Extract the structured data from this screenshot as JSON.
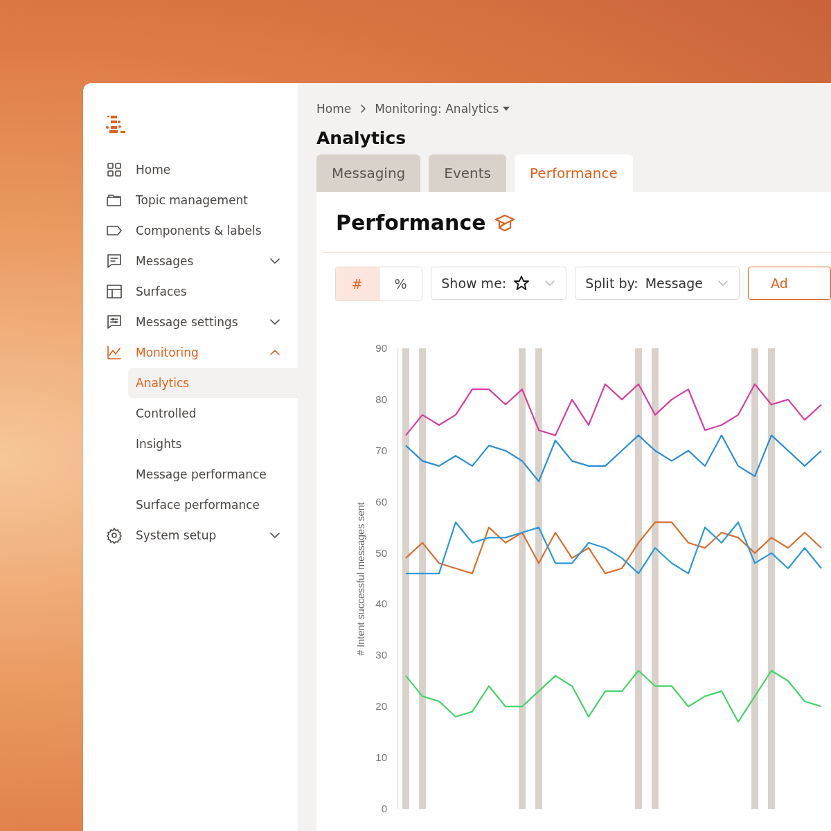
{
  "sidebar": {
    "items": [
      {
        "label": "Home",
        "kind": "link",
        "selected": false
      },
      {
        "label": "Topic management",
        "kind": "link",
        "selected": false
      },
      {
        "label": "Components & labels",
        "kind": "link",
        "selected": false
      },
      {
        "label": "Messages",
        "kind": "group",
        "selected": false,
        "expanded": false
      },
      {
        "label": "Surfaces",
        "kind": "link",
        "selected": false
      },
      {
        "label": "Message settings",
        "kind": "group",
        "selected": false,
        "expanded": false
      },
      {
        "label": "Monitoring",
        "kind": "group",
        "selected": true,
        "expanded": true,
        "children": [
          {
            "label": "Analytics",
            "selected": true
          },
          {
            "label": "Controlled",
            "selected": false
          },
          {
            "label": "Insights",
            "selected": false
          },
          {
            "label": "Message performance",
            "selected": false
          },
          {
            "label": "Surface performance",
            "selected": false
          }
        ]
      },
      {
        "label": "System setup",
        "kind": "group",
        "selected": false,
        "expanded": false
      }
    ]
  },
  "breadcrumb": [
    "Home",
    "Monitoring: Analytics"
  ],
  "page_title": "Analytics",
  "tabs": [
    {
      "label": "Messaging",
      "selected": false
    },
    {
      "label": "Events",
      "selected": false
    },
    {
      "label": "Performance",
      "selected": true
    }
  ],
  "panel": {
    "title": "Performance",
    "toolbar": {
      "units": [
        {
          "label": "#",
          "selected": true
        },
        {
          "label": "%",
          "selected": false
        }
      ],
      "show_me": {
        "label": "Show me:"
      },
      "split_by": {
        "label": "Split by:",
        "value": "Message"
      },
      "add_button": "Ad"
    },
    "chart_data": {
      "type": "line",
      "ylabel": "# Intent successful messages sent",
      "ylim": [
        0,
        90
      ],
      "yticks": [
        0,
        10,
        20,
        30,
        40,
        50,
        60,
        70,
        80,
        90
      ],
      "series": [
        {
          "color": "#d63fa0",
          "values": [
            73,
            77,
            75,
            77,
            82,
            82,
            79,
            82,
            74,
            73,
            80,
            75,
            83,
            80,
            83,
            77,
            80,
            82,
            74,
            75,
            77,
            83,
            79,
            80,
            76,
            79
          ]
        },
        {
          "color": "#2b8fd6",
          "values": [
            71,
            68,
            67,
            69,
            67,
            71,
            70,
            68,
            64,
            72,
            68,
            67,
            67,
            70,
            73,
            70,
            68,
            70,
            67,
            73,
            67,
            65,
            73,
            70,
            67,
            70
          ]
        },
        {
          "color": "#d9702f",
          "values": [
            49,
            52,
            48,
            47,
            46,
            55,
            52,
            54,
            48,
            54,
            49,
            51,
            46,
            47,
            52,
            56,
            56,
            52,
            51,
            54,
            53,
            50,
            53,
            51,
            54,
            51
          ]
        },
        {
          "color": "#2b9ad9",
          "values": [
            46,
            46,
            46,
            56,
            52,
            53,
            53,
            54,
            55,
            48,
            48,
            52,
            51,
            49,
            46,
            51,
            48,
            46,
            55,
            52,
            56,
            48,
            50,
            47,
            51,
            47
          ]
        },
        {
          "color": "#45d46b",
          "values": [
            26,
            22,
            21,
            18,
            19,
            24,
            20,
            20,
            23,
            26,
            24,
            18,
            23,
            23,
            27,
            24,
            24,
            20,
            22,
            23,
            17,
            22,
            27,
            25,
            21,
            20
          ]
        }
      ]
    }
  }
}
